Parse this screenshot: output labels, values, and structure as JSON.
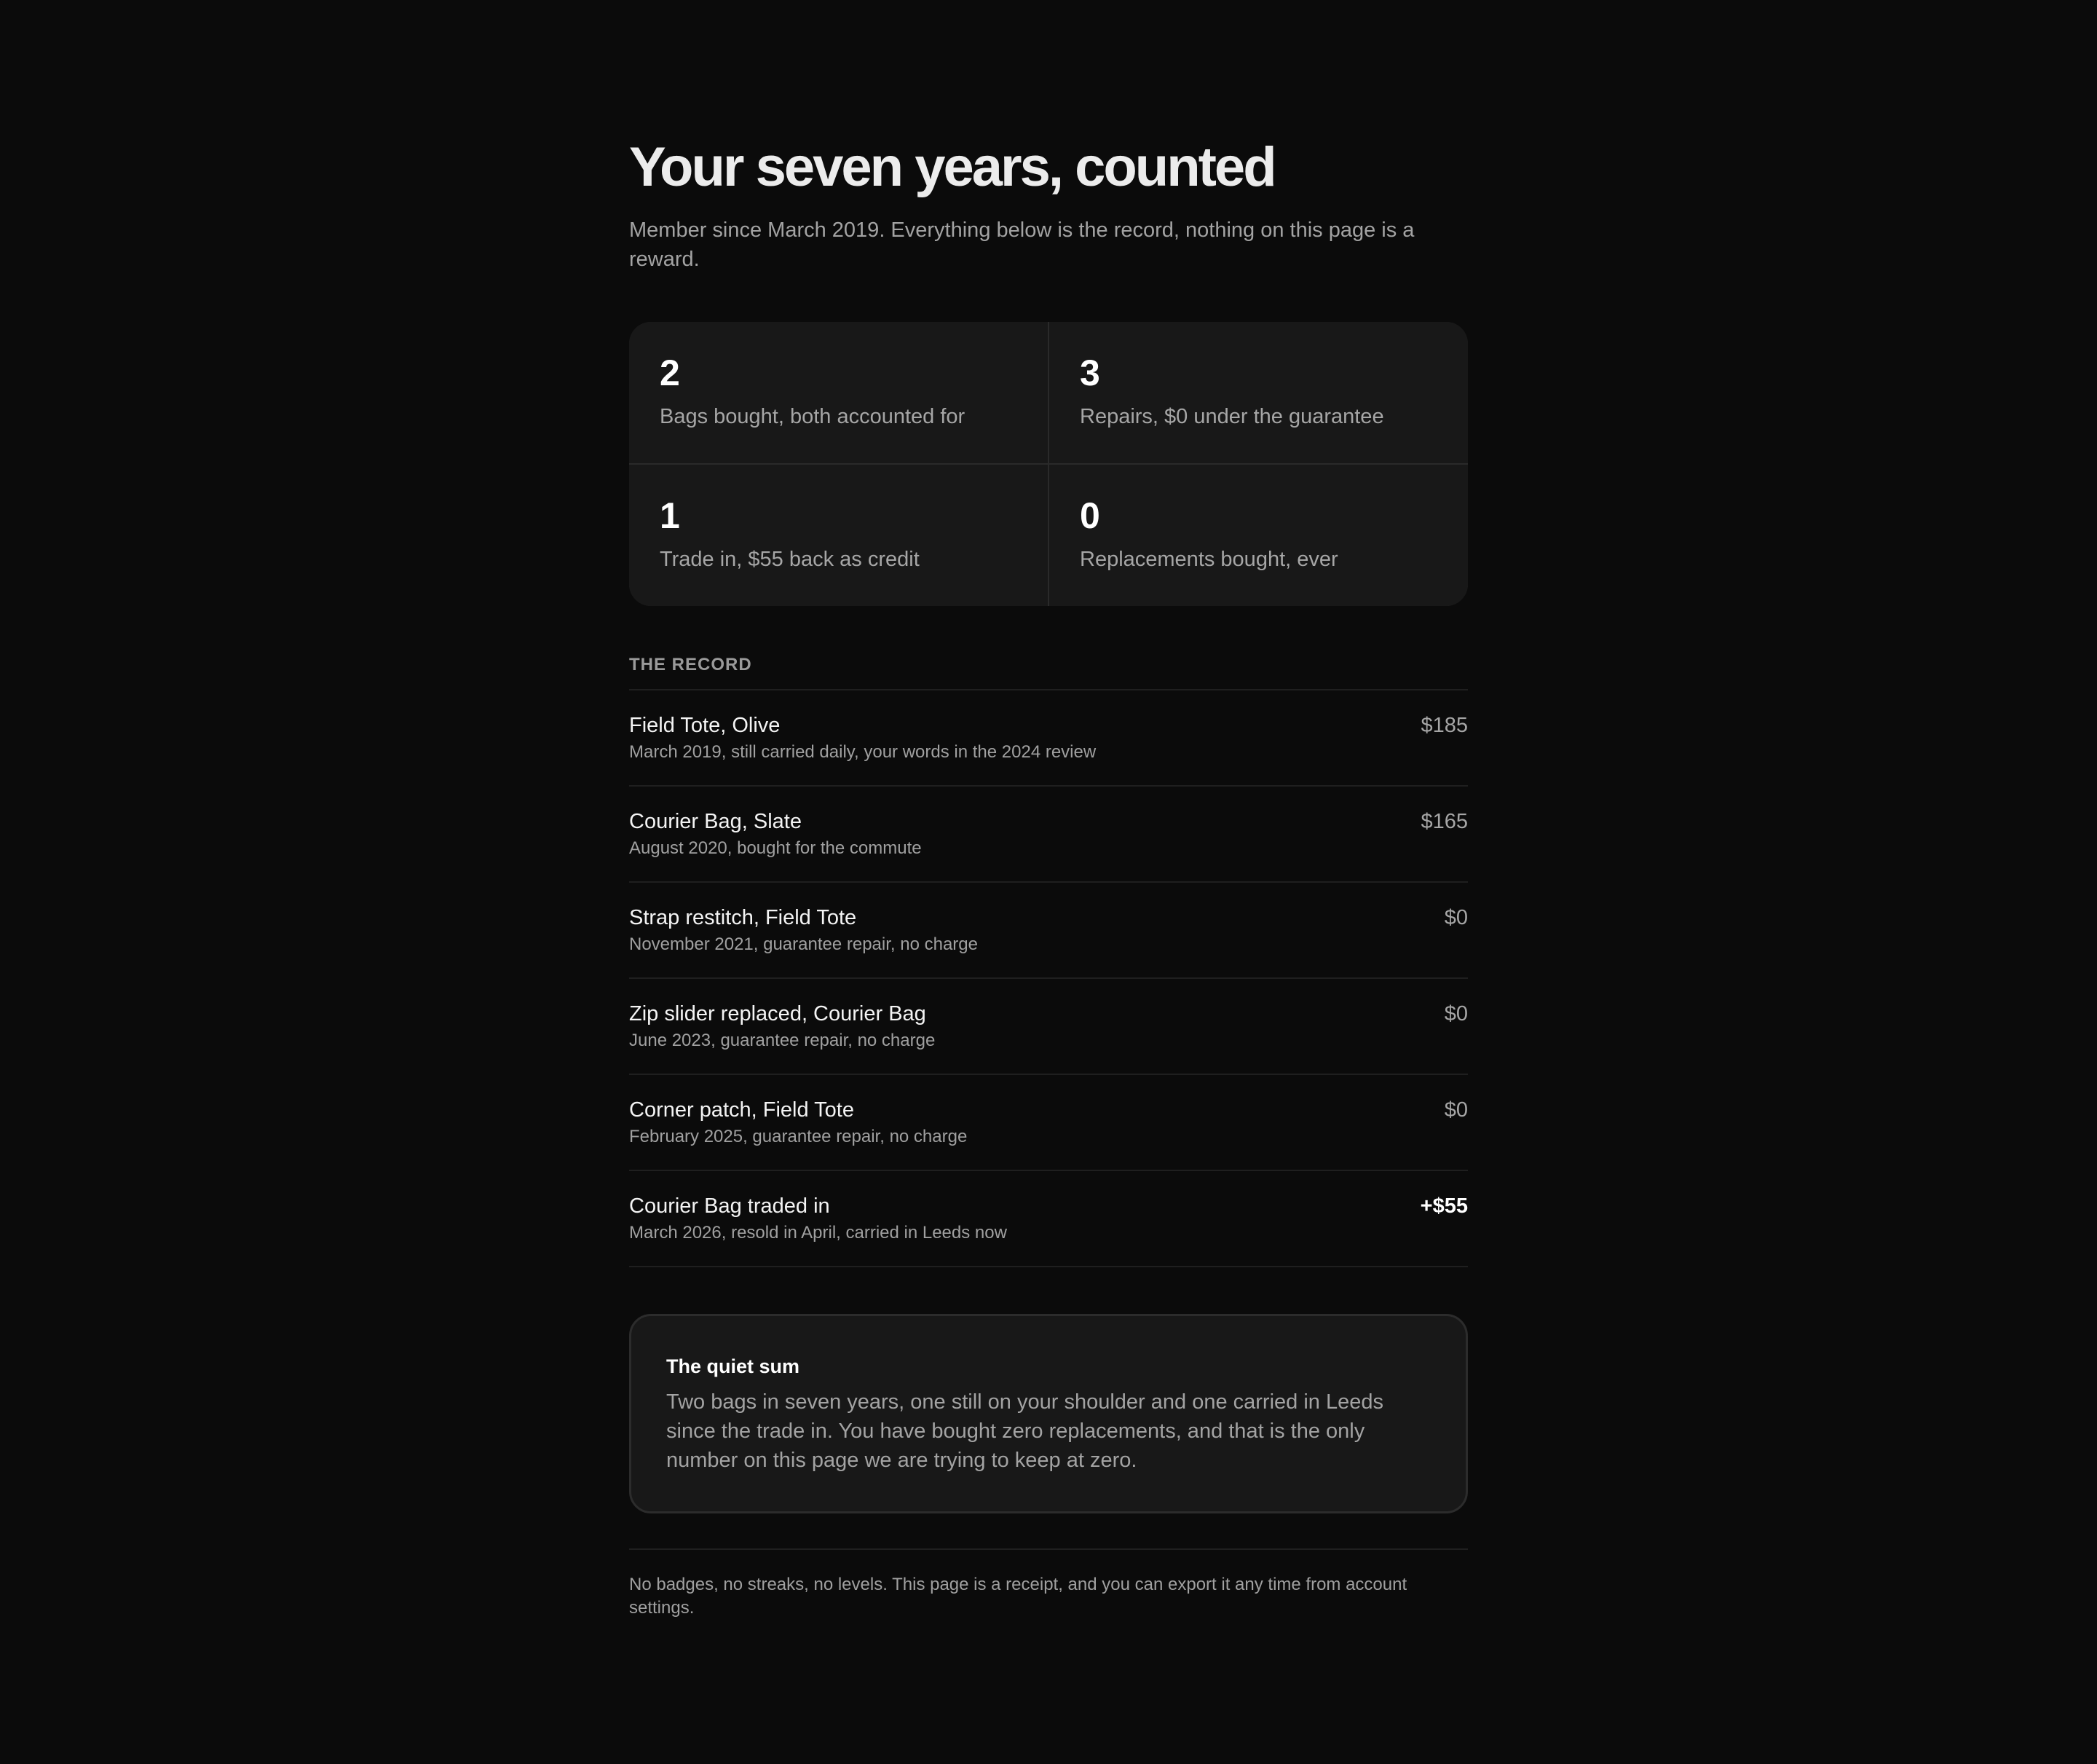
{
  "header": {
    "title": "Your seven years, counted",
    "subtitle": "Member since March 2019. Everything below is the record, nothing on this page is a reward."
  },
  "stats": [
    {
      "value": "2",
      "label": "Bags bought, both accounted for"
    },
    {
      "value": "3",
      "label": "Repairs, $0 under the guarantee"
    },
    {
      "value": "1",
      "label": "Trade in, $55 back as credit"
    },
    {
      "value": "0",
      "label": "Replacements bought, ever"
    }
  ],
  "record": {
    "heading": "THE RECORD",
    "items": [
      {
        "title": "Field Tote, Olive",
        "detail": "March 2019, still carried daily, your words in the 2024 review",
        "amount": "$185"
      },
      {
        "title": "Courier Bag, Slate",
        "detail": "August 2020, bought for the commute",
        "amount": "$165"
      },
      {
        "title": "Strap restitch, Field Tote",
        "detail": "November 2021, guarantee repair, no charge",
        "amount": "$0"
      },
      {
        "title": "Zip slider replaced, Courier Bag",
        "detail": "June 2023, guarantee repair, no charge",
        "amount": "$0"
      },
      {
        "title": "Corner patch, Field Tote",
        "detail": "February 2025, guarantee repair, no charge",
        "amount": "$0"
      },
      {
        "title": "Courier Bag traded in",
        "detail": "March 2026, resold in April, carried in Leeds now",
        "amount": "+$55"
      }
    ]
  },
  "summary": {
    "title": "The quiet sum",
    "body": "Two bags in seven years, one still on your shoulder and one carried in Leeds since the trade in. You have bought zero replacements, and that is the only number on this page we are trying to keep at zero."
  },
  "footer": {
    "note": "No badges, no streaks, no levels. This page is a receipt, and you can export it any time from account settings."
  }
}
